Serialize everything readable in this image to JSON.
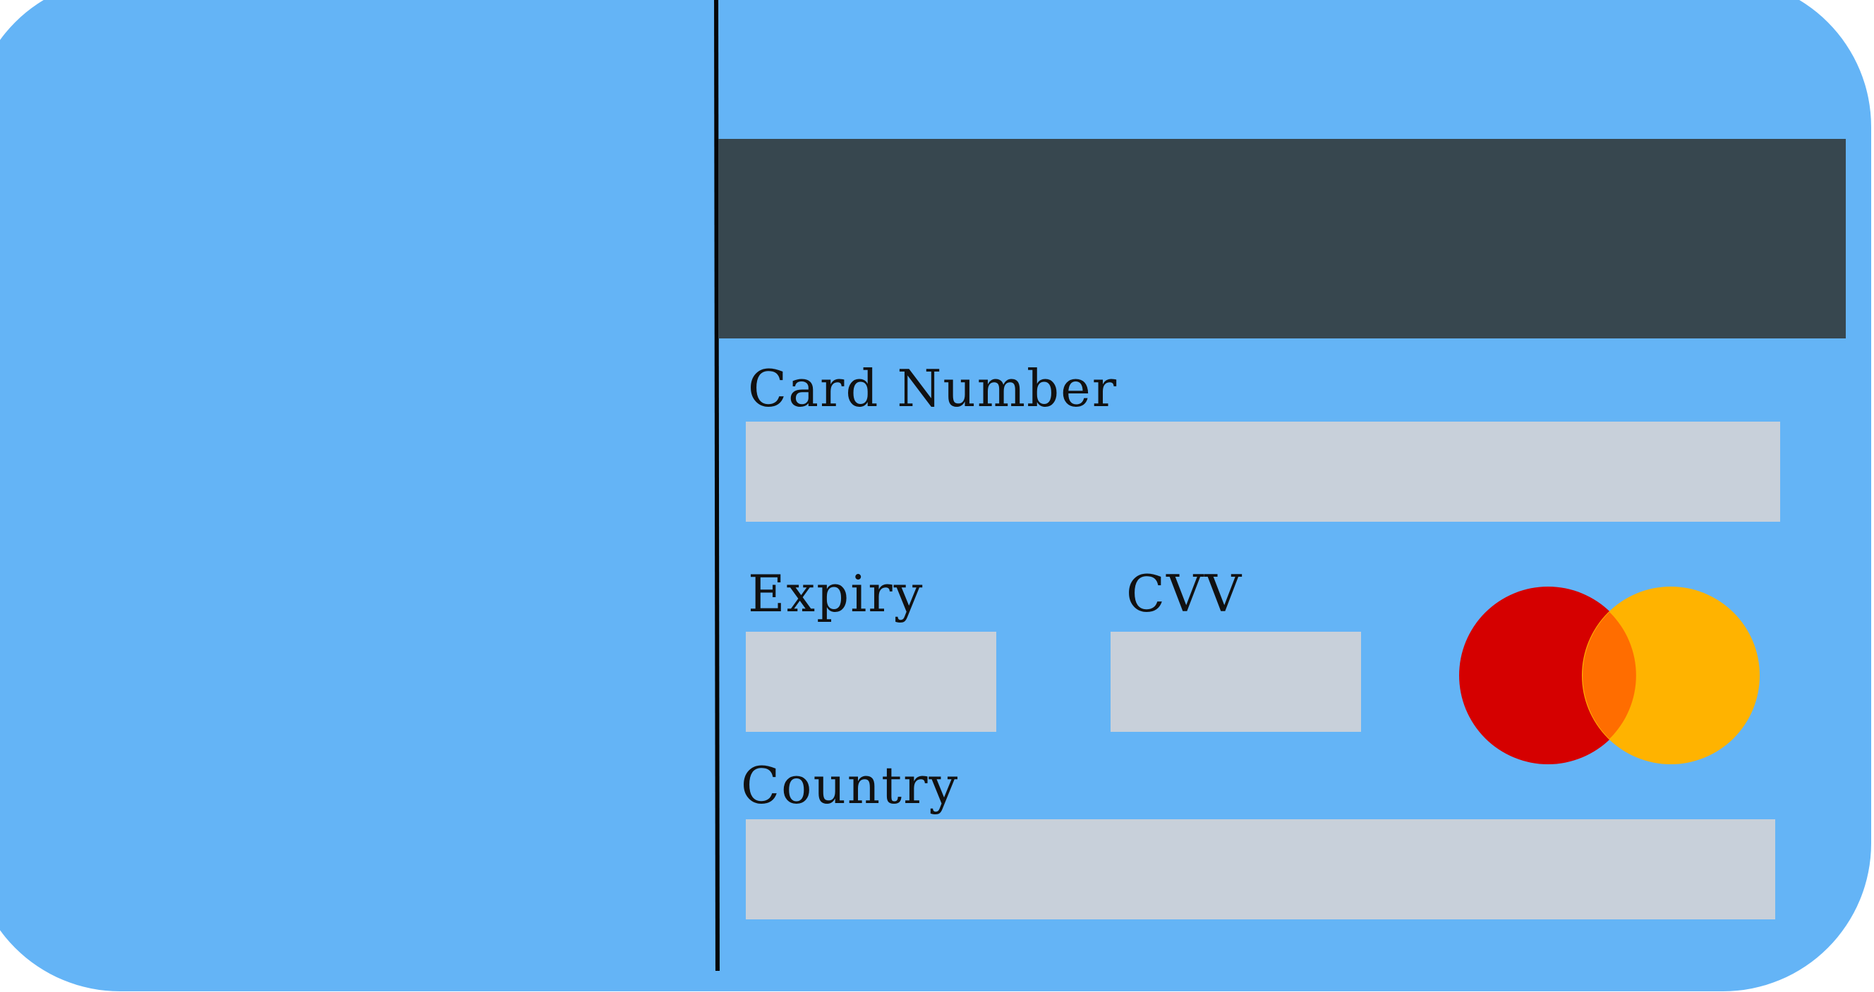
{
  "colors": {
    "card_background": "#64b4f6",
    "magnetic_stripe": "#37474f",
    "field_background": "#c8d0da",
    "divider": "#050505",
    "brand_red": "#d50000",
    "brand_yellow": "#ffb300",
    "brand_overlap": "#ff6d00"
  },
  "form": {
    "card_number_label": "Card Number",
    "card_number_value": "",
    "expiry_label": "Expiry",
    "expiry_value": "",
    "cvv_label": "CVV",
    "cvv_value": "",
    "country_label": "Country",
    "country_value": ""
  },
  "icons": {
    "brand_logo": "mastercard-logo-icon"
  }
}
